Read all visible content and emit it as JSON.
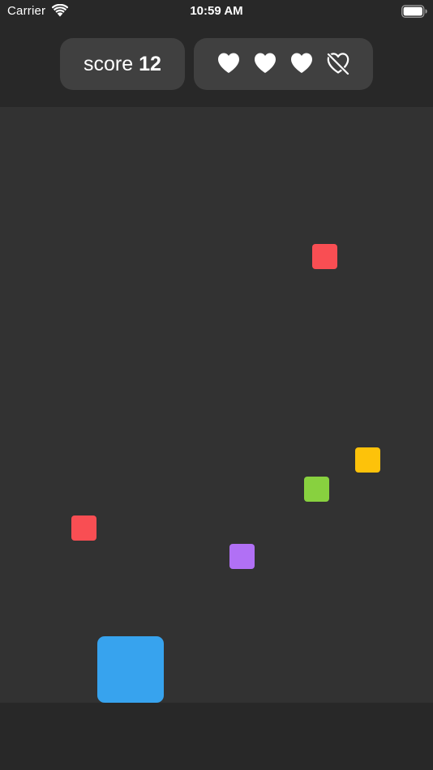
{
  "status_bar": {
    "carrier": "Carrier",
    "time": "10:59 AM"
  },
  "hud": {
    "score_label": "score",
    "score_value": "12",
    "lives": [
      {
        "icon": "heart-filled-icon",
        "state": "full"
      },
      {
        "icon": "heart-filled-icon",
        "state": "full"
      },
      {
        "icon": "heart-filled-icon",
        "state": "full"
      },
      {
        "icon": "heart-slash-icon",
        "state": "lost"
      }
    ]
  },
  "game": {
    "player_color": "#37a3ee",
    "block_colors": {
      "red": "#f94e53",
      "yellow": "#fdc20a",
      "green": "#88d13f",
      "purple": "#b170f5"
    }
  },
  "colors": {
    "background": "#282828",
    "game_area": "#323232",
    "hud_panel": "#404040",
    "text": "#ffffff"
  }
}
